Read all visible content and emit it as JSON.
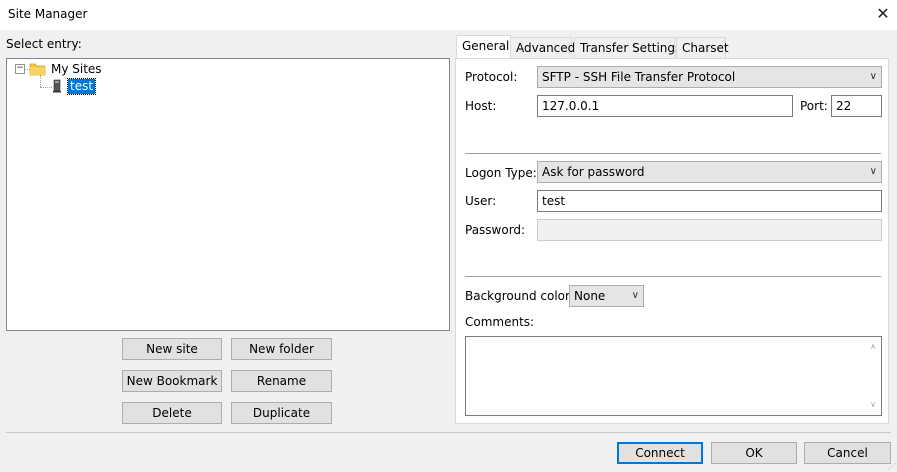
{
  "window": {
    "title": "Site Manager",
    "close_glyph": "✕"
  },
  "left": {
    "select_entry_label": "Select entry:",
    "tree": {
      "root": {
        "label": "My Sites",
        "expander": "⊟"
      },
      "child": {
        "label": "test"
      }
    },
    "buttons": {
      "new_site": "New site",
      "new_folder": "New folder",
      "new_bookmark": "New Bookmark",
      "rename": "Rename",
      "delete": "Delete",
      "duplicate": "Duplicate"
    }
  },
  "tabs": [
    "General",
    "Advanced",
    "Transfer Settings",
    "Charset"
  ],
  "general": {
    "protocol_label": "Protocol:",
    "protocol_value": "SFTP - SSH File Transfer Protocol",
    "host_label": "Host:",
    "host_value": "127.0.0.1",
    "port_label": "Port:",
    "port_value": "22",
    "logon_type_label": "Logon Type:",
    "logon_type_value": "Ask for password",
    "user_label": "User:",
    "user_value": "test",
    "password_label": "Password:",
    "password_value": "",
    "bg_color_label": "Background color:",
    "bg_color_value": "None",
    "comments_label": "Comments:",
    "comments_value": ""
  },
  "footer": {
    "connect": "Connect",
    "ok": "OK",
    "cancel": "Cancel"
  },
  "colors": {
    "accent": "#0078d7",
    "folder": "#f4c542"
  }
}
